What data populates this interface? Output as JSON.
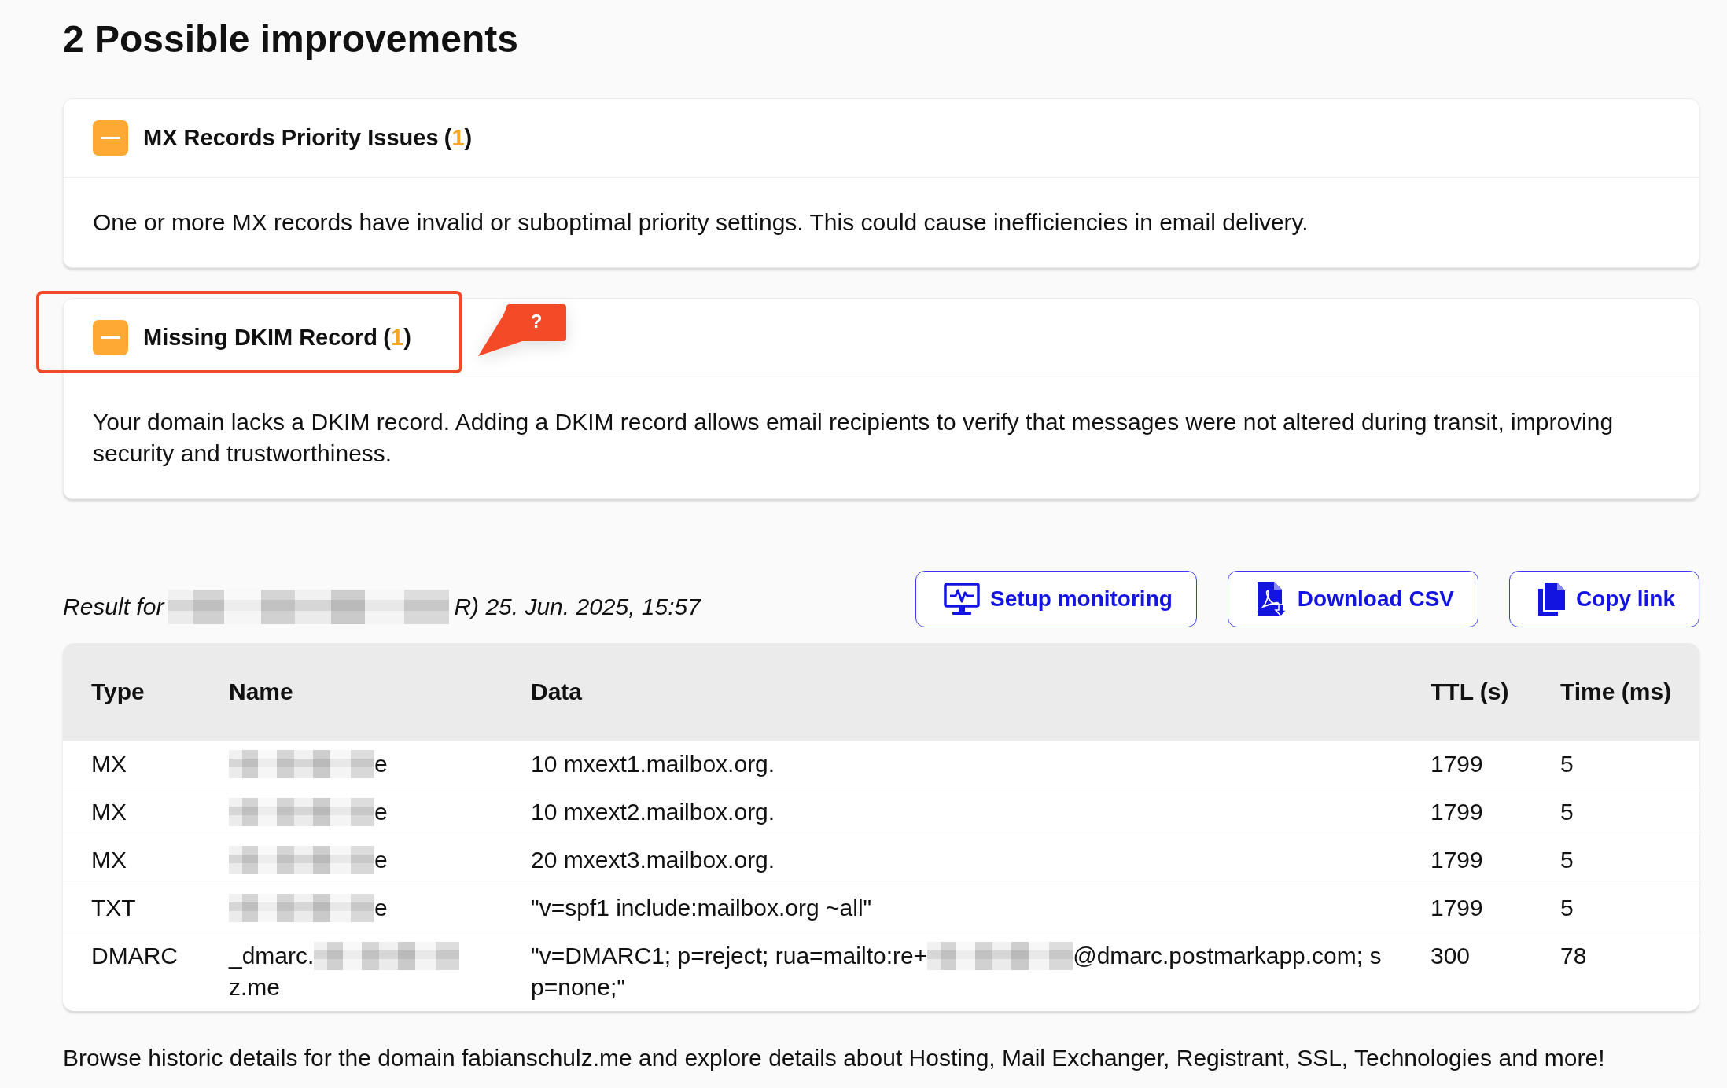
{
  "heading": "2 Possible improvements",
  "cards": [
    {
      "title": "MX Records Priority Issues",
      "count": "(1)",
      "expanded": true,
      "highlighted": false,
      "description": "One or more MX records have invalid or suboptimal priority settings. This could cause inefficiencies in email delivery."
    },
    {
      "title": "Missing DKIM Record",
      "count": "(1)",
      "expanded": true,
      "highlighted": true,
      "callout": "?",
      "description": "Your domain lacks a DKIM record. Adding a DKIM record allows email recipients to verify that messages were not altered during transit, improving security and trustworthiness."
    }
  ],
  "result_line": [
    {
      "kind": "text",
      "text": "Result for"
    },
    {
      "kind": "redacted"
    },
    {
      "kind": "text",
      "text": "R) 25. Jun. 2025, 15:57"
    }
  ],
  "actions": [
    {
      "label": "Setup monitoring"
    },
    {
      "label": "Download CSV"
    },
    {
      "label": "Copy link"
    }
  ],
  "table": {
    "columns": [
      "Type",
      "Name",
      "Data",
      "TTL (s)",
      "Time (ms)"
    ],
    "rows": [
      {
        "type": "MX",
        "name": [
          [
            {
              "kind": "redacted"
            },
            {
              "kind": "text",
              "text": "e"
            }
          ]
        ],
        "data": [
          [
            {
              "kind": "text",
              "text": "10 mxext1.mailbox.org."
            }
          ]
        ],
        "ttl": "1799",
        "time": "5"
      },
      {
        "type": "MX",
        "name": [
          [
            {
              "kind": "redacted"
            },
            {
              "kind": "text",
              "text": "e"
            }
          ]
        ],
        "data": [
          [
            {
              "kind": "text",
              "text": "10 mxext2.mailbox.org."
            }
          ]
        ],
        "ttl": "1799",
        "time": "5"
      },
      {
        "type": "MX",
        "name": [
          [
            {
              "kind": "redacted"
            },
            {
              "kind": "text",
              "text": "e"
            }
          ]
        ],
        "data": [
          [
            {
              "kind": "text",
              "text": "20 mxext3.mailbox.org."
            }
          ]
        ],
        "ttl": "1799",
        "time": "5"
      },
      {
        "type": "TXT",
        "name": [
          [
            {
              "kind": "redacted"
            },
            {
              "kind": "text",
              "text": "e"
            }
          ]
        ],
        "data": [
          [
            {
              "kind": "text",
              "text": "\"v=spf1 include:mailbox.org ~all\""
            }
          ]
        ],
        "ttl": "1799",
        "time": "5"
      },
      {
        "type": "DMARC",
        "name": [
          [
            {
              "kind": "text",
              "text": "_dmarc."
            },
            {
              "kind": "redacted"
            }
          ],
          [
            {
              "kind": "text",
              "text": "z.me"
            }
          ]
        ],
        "data": [
          [
            {
              "kind": "text",
              "text": "\"v=DMARC1; p=reject; rua=mailto:re+"
            },
            {
              "kind": "redacted"
            },
            {
              "kind": "text",
              "text": "@dmarc.postmarkapp.com; s"
            }
          ],
          [
            {
              "kind": "text",
              "text": "p=none;\""
            }
          ]
        ],
        "ttl": "300",
        "time": "78"
      }
    ]
  },
  "footer_text": "Browse historic details for the domain fabianschulz.me and explore details about Hosting, Mail Exchanger, Registrant, SSL, Technologies and more!"
}
